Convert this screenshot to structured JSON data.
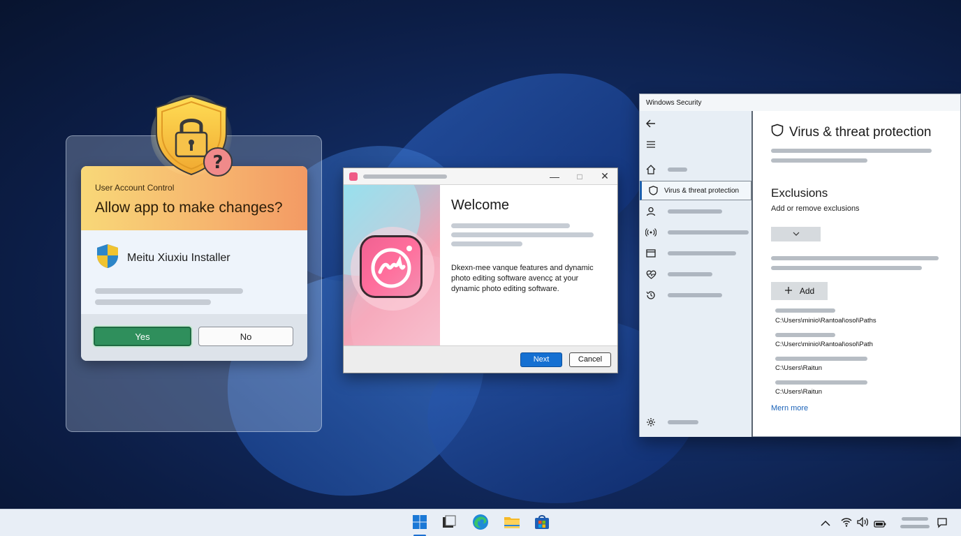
{
  "uac": {
    "title": "User Account Control",
    "question": "Allow app to make changes?",
    "app_name": "Meitu Xiuxiu Installer",
    "yes_label": "Yes",
    "no_label": "No"
  },
  "installer": {
    "welcome": "Welcome",
    "description_line1": "Dkexn-mee vanque features and dynamic",
    "description_line2": "photo editing software avencc̱ at your",
    "description_line3": "dynamic photo editing software.",
    "next_label": "Next",
    "cancel_label": "Cancel",
    "window_controls": [
      "—",
      "□",
      "✕"
    ]
  },
  "security": {
    "window_title": "Windows Security",
    "nav_active_label": "Virus & threat protection",
    "heading": "Virus & threat protection",
    "exclusions_title": "Exclusions",
    "exclusions_desc": "Add or remove exclusions",
    "add_label": "Add",
    "paths": [
      "C:\\Users\\minio\\Rantoal\\osol\\Paths",
      "C:\\Userc\\minio\\Rantoal\\osol\\Path",
      "C:\\Users\\Raitun",
      "C:\\Users\\Raitun"
    ],
    "more_link": "Mern more"
  },
  "taskbar": {
    "apps": [
      "start-icon",
      "task-view-icon",
      "edge-icon",
      "file-explorer-icon",
      "store-icon"
    ],
    "tray": [
      "chevron-up-icon",
      "wifi-icon",
      "volume-icon",
      "battery-icon",
      "notification-icon"
    ]
  },
  "colors": {
    "yes_button": "#2f8f5c",
    "next_button": "#1570d2",
    "nav_accent": "#1b5fae",
    "uac_header_start": "#f8d878",
    "uac_header_end": "#f39a64"
  }
}
